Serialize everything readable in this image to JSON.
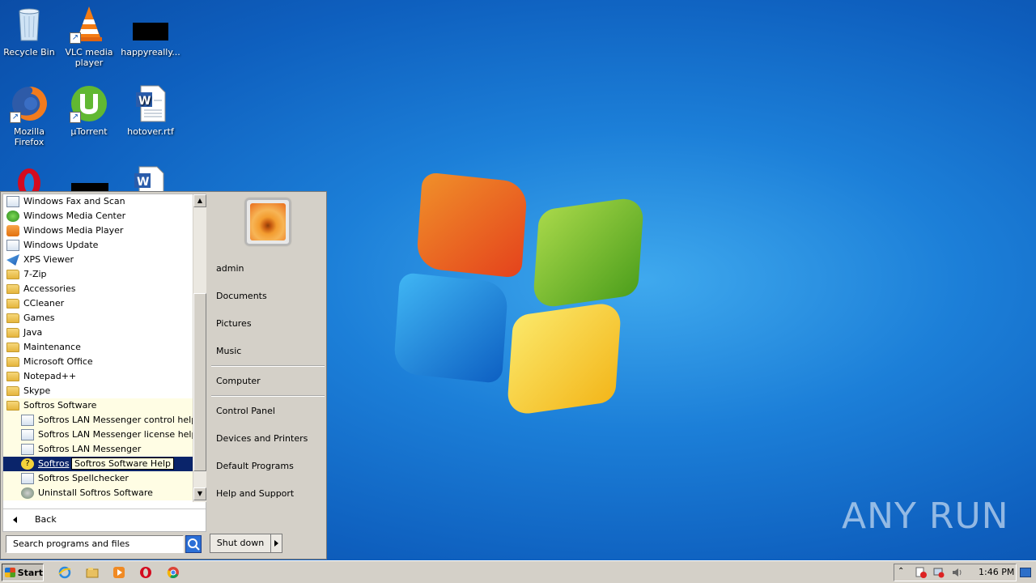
{
  "desktop": {
    "icons": [
      {
        "label": "Recycle Bin",
        "icon": "recycle-bin-icon"
      },
      {
        "label": "VLC media player",
        "icon": "vlc-icon"
      },
      {
        "label": "happyreally...",
        "icon": "black-thumbnail-icon"
      },
      {
        "label": "Mozilla Firefox",
        "icon": "firefox-icon"
      },
      {
        "label": "µTorrent",
        "icon": "utorrent-icon"
      },
      {
        "label": "hotover.rtf",
        "icon": "word-document-icon"
      }
    ],
    "watermark": "ANY RUN"
  },
  "start_menu": {
    "programs": [
      {
        "label": "Windows Fax and Scan",
        "icon": "fax-icon"
      },
      {
        "label": "Windows Media Center",
        "icon": "media-center-icon"
      },
      {
        "label": "Windows Media Player",
        "icon": "media-player-icon"
      },
      {
        "label": "Windows Update",
        "icon": "windows-update-icon"
      },
      {
        "label": "XPS Viewer",
        "icon": "xps-viewer-icon"
      },
      {
        "label": "7-Zip",
        "icon": "folder-icon"
      },
      {
        "label": "Accessories",
        "icon": "folder-icon"
      },
      {
        "label": "CCleaner",
        "icon": "folder-icon"
      },
      {
        "label": "Games",
        "icon": "folder-icon"
      },
      {
        "label": "Java",
        "icon": "folder-icon"
      },
      {
        "label": "Maintenance",
        "icon": "folder-icon"
      },
      {
        "label": "Microsoft Office",
        "icon": "folder-icon"
      },
      {
        "label": "Notepad++",
        "icon": "folder-icon"
      },
      {
        "label": "Skype",
        "icon": "folder-icon"
      },
      {
        "label": "Softros Software",
        "icon": "folder-icon"
      },
      {
        "label": "Softros LAN Messenger control helper",
        "icon": "app-icon"
      },
      {
        "label": "Softros LAN Messenger license helper",
        "icon": "app-icon"
      },
      {
        "label": "Softros LAN Messenger",
        "icon": "app-icon"
      },
      {
        "label": "Softros",
        "icon": "help-icon"
      },
      {
        "label": "Softros Spellchecker",
        "icon": "app-icon"
      },
      {
        "label": "Uninstall Softros Software",
        "icon": "uninstall-icon"
      }
    ],
    "tooltip": "Softros Software Help",
    "back_label": "Back",
    "search_placeholder": "Search programs and files",
    "right_items": {
      "user": "admin",
      "documents": "Documents",
      "pictures": "Pictures",
      "music": "Music",
      "computer": "Computer",
      "control_panel": "Control Panel",
      "devices": "Devices and Printers",
      "default_programs": "Default Programs",
      "help": "Help and Support"
    },
    "shutdown_label": "Shut down"
  },
  "taskbar": {
    "start_label": "Start",
    "pinned": [
      "ie-icon",
      "explorer-icon",
      "media-player-icon",
      "opera-icon",
      "chrome-icon"
    ],
    "clock": "1:46 PM"
  }
}
